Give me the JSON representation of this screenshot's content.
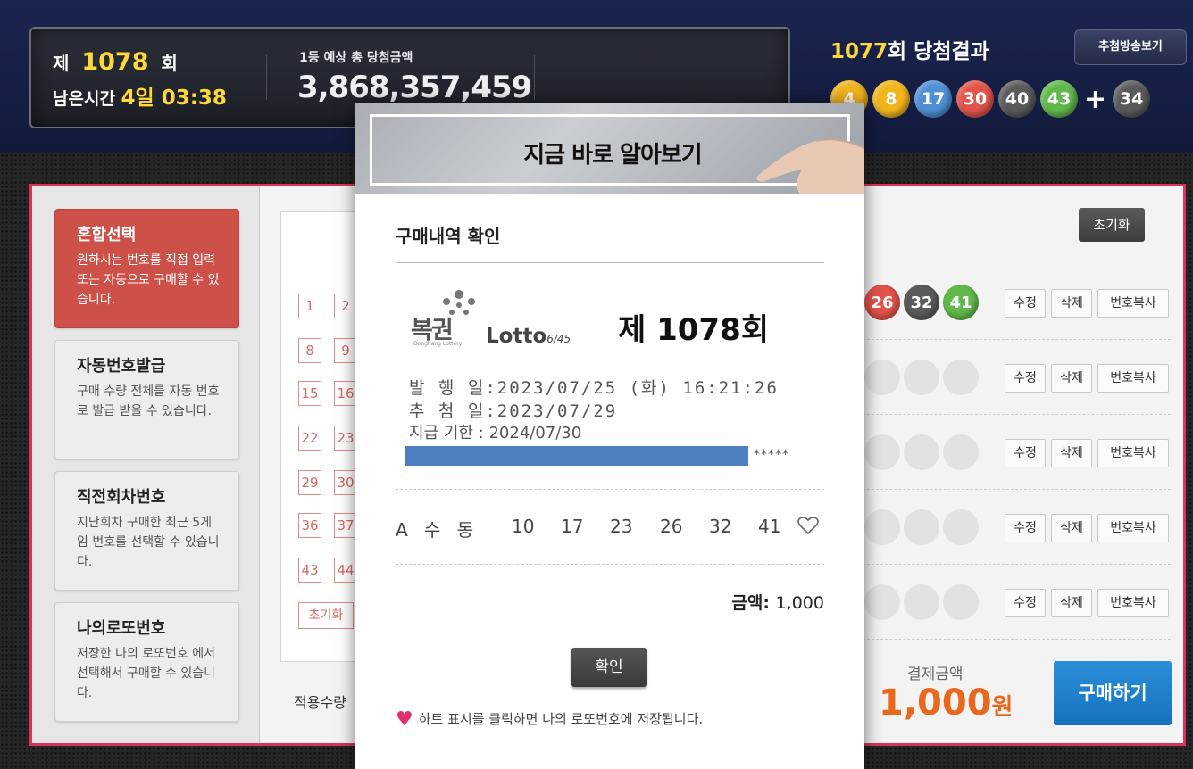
{
  "header": {
    "round_prefix": "제",
    "round_number": "1078",
    "round_suffix": "회",
    "remain_label": "남은시간",
    "remain_time": "4일 03:38",
    "jackpot_label": "1등 예상 총 당첨금액",
    "jackpot_amount": "3,868,357,459",
    "last_round_number": "1077",
    "last_round_suffix": "회 당첨결과",
    "replay_button": "추첨방송보기",
    "winning_numbers": [
      "4",
      "8",
      "17",
      "30",
      "40",
      "43"
    ],
    "bonus_number": "34",
    "plus": "+"
  },
  "sidebar": {
    "items": [
      {
        "title": "혼합선택",
        "desc": "원하시는 번호를 직접 입력 또는 자동으로 구매할 수 있습니다."
      },
      {
        "title": "자동번호발급",
        "desc": "구매 수량 전체를 자동 번호로 발급 받을 수 있습니다."
      },
      {
        "title": "직전회차번호",
        "desc": "지난회차 구매한 최근 5게임 번호를 선택할 수 있습니다."
      },
      {
        "title": "나의로또번호",
        "desc": "저장한 나의 로또번호 에서 선택해서 구매할 수 있습니다."
      }
    ]
  },
  "grid": {
    "numbers": [
      "1",
      "2",
      "8",
      "9",
      "15",
      "16",
      "22",
      "23",
      "29",
      "30",
      "36",
      "37",
      "43",
      "44"
    ],
    "reset_label": "초기화",
    "apply_label": "적용수량"
  },
  "right": {
    "reset_label": "초기화",
    "row1_numbers": [
      "26",
      "32",
      "41"
    ],
    "btn_edit": "수정",
    "btn_delete": "삭제",
    "btn_copy": "번호복사",
    "pay_label": "결제금액",
    "pay_amount": "1,000",
    "pay_unit": "원",
    "buy_label": "구매하기"
  },
  "modal": {
    "banner_text": "지금 바로 알아보기",
    "title": "구매내역 확인",
    "logo_text": "복권",
    "logo_sub": "Donghang Lottery",
    "logo_lotto": "Lotto",
    "logo_lotto_sub": "6/45",
    "round_text": "제 1078회",
    "issue_line": "발 행 일:2023/07/25 (화) 16:21:26",
    "draw_line": "추 첨 일:2023/07/29",
    "deadline_line": "지급 기한 : 2024/07/30",
    "masked_stars": "*****",
    "game_label": "A 수 동",
    "game_numbers": [
      "10",
      "17",
      "23",
      "26",
      "32",
      "41"
    ],
    "amount_label": "금액:",
    "amount_value": "1,000",
    "confirm_label": "확인",
    "hint_text": "하트 표시를 클릭하면 나의 로또번호에 저장됩니다."
  },
  "colors": {
    "ball_yellow": "#f2b51d",
    "ball_blue": "#4f8fd6",
    "ball_red": "#e2534a",
    "ball_gray": "#5a5a5a",
    "ball_green": "#61b84b",
    "accent_pink": "#d8345a",
    "pay_orange": "#e8681e",
    "buy_blue": "#1a7fcf"
  }
}
